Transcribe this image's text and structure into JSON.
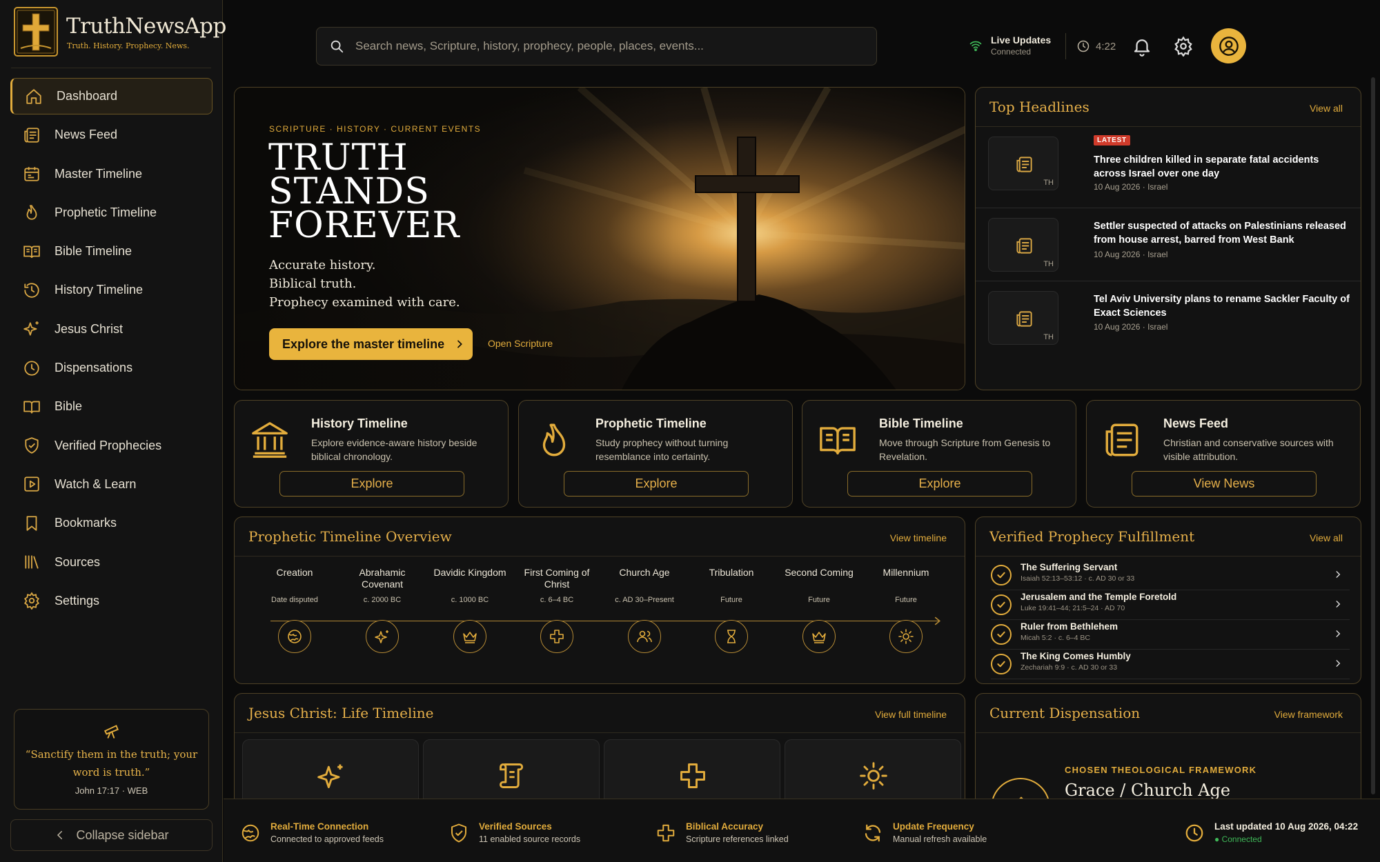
{
  "app": {
    "name": "TruthNewsApp",
    "tagline": "Truth. History. Prophecy. News.",
    "accent": "#e2ac3c",
    "background": "#0b0b0b"
  },
  "sidebar": {
    "items": [
      {
        "label": "Dashboard",
        "icon": "home-icon",
        "active": true
      },
      {
        "label": "News Feed",
        "icon": "newspaper-icon"
      },
      {
        "label": "Master Timeline",
        "icon": "calendar-icon"
      },
      {
        "label": "Prophetic Timeline",
        "icon": "flame-icon"
      },
      {
        "label": "Bible Timeline",
        "icon": "open-book-icon"
      },
      {
        "label": "History Timeline",
        "icon": "history-icon"
      },
      {
        "label": "Jesus Christ",
        "icon": "sparkle-icon"
      },
      {
        "label": "Dispensations",
        "icon": "clock-icon"
      },
      {
        "label": "Bible",
        "icon": "book-icon"
      },
      {
        "label": "Verified Prophecies",
        "icon": "shield-check-icon"
      },
      {
        "label": "Watch & Learn",
        "icon": "play-icon"
      },
      {
        "label": "Bookmarks",
        "icon": "bookmark-icon"
      },
      {
        "label": "Sources",
        "icon": "library-icon"
      },
      {
        "label": "Settings",
        "icon": "gear-icon"
      }
    ],
    "quote": {
      "text": "“Sanctify them in the truth; your word is truth.”",
      "reference": "John 17:17 · WEB"
    },
    "collapse_label": "Collapse sidebar"
  },
  "topbar": {
    "search_placeholder": "Search news, Scripture, history, prophecy, people, places, events...",
    "live_title": "Live Updates",
    "live_status": "Connected",
    "time": "4:22"
  },
  "hero": {
    "kicker": "SCRIPTURE · HISTORY · CURRENT EVENTS",
    "title_lines": [
      "TRUTH",
      "STANDS",
      "FOREVER"
    ],
    "lines": [
      "Accurate history.",
      "Biblical truth.",
      "Prophecy examined with care."
    ],
    "cta": "Explore the master timeline",
    "secondary": "Open Scripture"
  },
  "headlines": {
    "title": "Top Headlines",
    "view_all": "View all",
    "items": [
      {
        "badge": "LATEST",
        "thumb": "TH",
        "title": "Three children killed in separate fatal accidents across Israel over one day",
        "meta": "10 Aug 2026 · Israel"
      },
      {
        "thumb": "TH",
        "title": "Settler suspected of attacks on Palestinians released from house arrest, barred from West Bank",
        "meta": "10 Aug 2026 · Israel"
      },
      {
        "thumb": "TH",
        "title": "Tel Aviv University plans to rename Sackler Faculty of Exact Sciences",
        "meta": "10 Aug 2026 · Israel"
      }
    ]
  },
  "cards": [
    {
      "title": "History Timeline",
      "desc": "Explore evidence-aware history beside biblical chronology.",
      "button": "Explore",
      "icon": "columns-icon"
    },
    {
      "title": "Prophetic Timeline",
      "desc": "Study prophecy without turning resemblance into certainty.",
      "button": "Explore",
      "icon": "flame-icon"
    },
    {
      "title": "Bible Timeline",
      "desc": "Move through Scripture from Genesis to Revelation.",
      "button": "Explore",
      "icon": "open-book-icon"
    },
    {
      "title": "News Feed",
      "desc": "Christian and conservative sources with visible attribution.",
      "button": "View News",
      "icon": "newspaper-icon"
    }
  ],
  "prophetic_overview": {
    "title": "Prophetic Timeline Overview",
    "link": "View timeline",
    "eras": [
      {
        "label": "Creation",
        "date": "Date disputed",
        "icon": "globe-icon"
      },
      {
        "label": "Abrahamic Covenant",
        "date": "c. 2000 BC",
        "icon": "sparkle-icon"
      },
      {
        "label": "Davidic Kingdom",
        "date": "c. 1000 BC",
        "icon": "crown-icon"
      },
      {
        "label": "First Coming of Christ",
        "date": "c. 6–4 BC",
        "icon": "cross-icon"
      },
      {
        "label": "Church Age",
        "date": "c. AD 30–Present",
        "icon": "people-icon"
      },
      {
        "label": "Tribulation",
        "date": "Future",
        "icon": "hourglass-icon"
      },
      {
        "label": "Second Coming",
        "date": "Future",
        "icon": "crown-icon"
      },
      {
        "label": "Millennium",
        "date": "Future",
        "icon": "sun-icon"
      }
    ]
  },
  "verified": {
    "title": "Verified Prophecy Fulfillment",
    "view_all": "View all",
    "items": [
      {
        "title": "The Suffering Servant",
        "meta": "Isaiah 52:13–53:12 · c. AD 30 or 33"
      },
      {
        "title": "Jerusalem and the Temple Foretold",
        "meta": "Luke 19:41–44; 21:5–24 · AD 70"
      },
      {
        "title": "Ruler from Bethlehem",
        "meta": "Micah 5:2 · c. 6–4 BC"
      },
      {
        "title": "The King Comes Humbly",
        "meta": "Zechariah 9:9 · c. AD 30 or 33"
      }
    ]
  },
  "jesus_life": {
    "title": "Jesus Christ: Life Timeline",
    "link": "View full timeline",
    "icons": [
      "sparkle-icon",
      "scroll-icon",
      "cross-icon",
      "sun-icon"
    ]
  },
  "dispensation": {
    "title": "Current Dispensation",
    "link": "View framework",
    "kicker": "CHOSEN THEOLOGICAL FRAMEWORK",
    "name": "Grace / Church Age"
  },
  "status": [
    {
      "title": "Real-Time Connection",
      "sub": "Connected to approved feeds",
      "icon": "globe-icon"
    },
    {
      "title": "Verified Sources",
      "sub": "11 enabled source records",
      "icon": "shield-check-icon"
    },
    {
      "title": "Biblical Accuracy",
      "sub": "Scripture references linked",
      "icon": "cross-icon"
    },
    {
      "title": "Update Frequency",
      "sub": "Manual refresh available",
      "icon": "refresh-icon"
    }
  ],
  "last_updated": {
    "title": "Last updated 10 Aug 2026, 04:22",
    "status": "● Connected"
  }
}
